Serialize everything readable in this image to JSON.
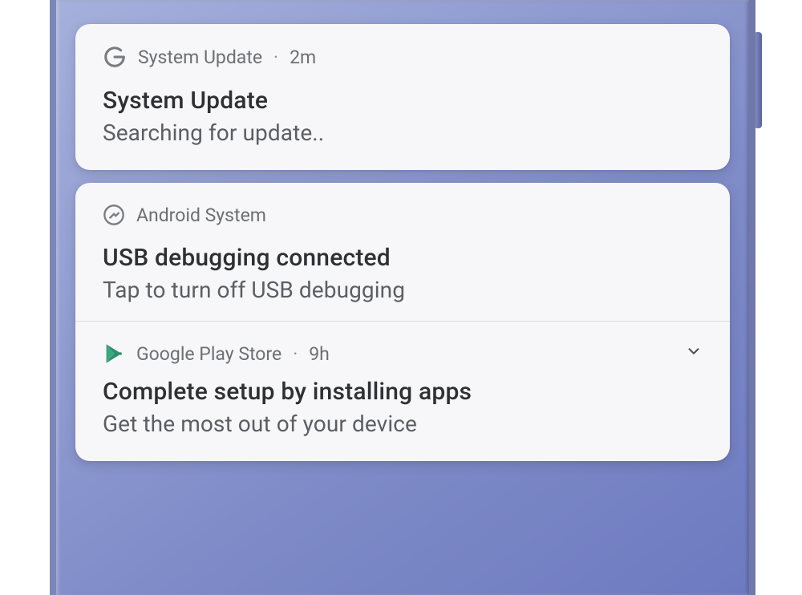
{
  "notifications": [
    {
      "app_name": "System Update",
      "time": "2m",
      "title": "System Update",
      "body": "Searching for update.."
    },
    {
      "app_name": "Android System",
      "time": "",
      "title": "USB debugging connected",
      "body": "Tap to turn off USB debugging"
    },
    {
      "app_name": "Google Play Store",
      "time": "9h",
      "title": "Complete setup by installing apps",
      "body": "Get the most out of your device"
    }
  ],
  "separator": "·"
}
